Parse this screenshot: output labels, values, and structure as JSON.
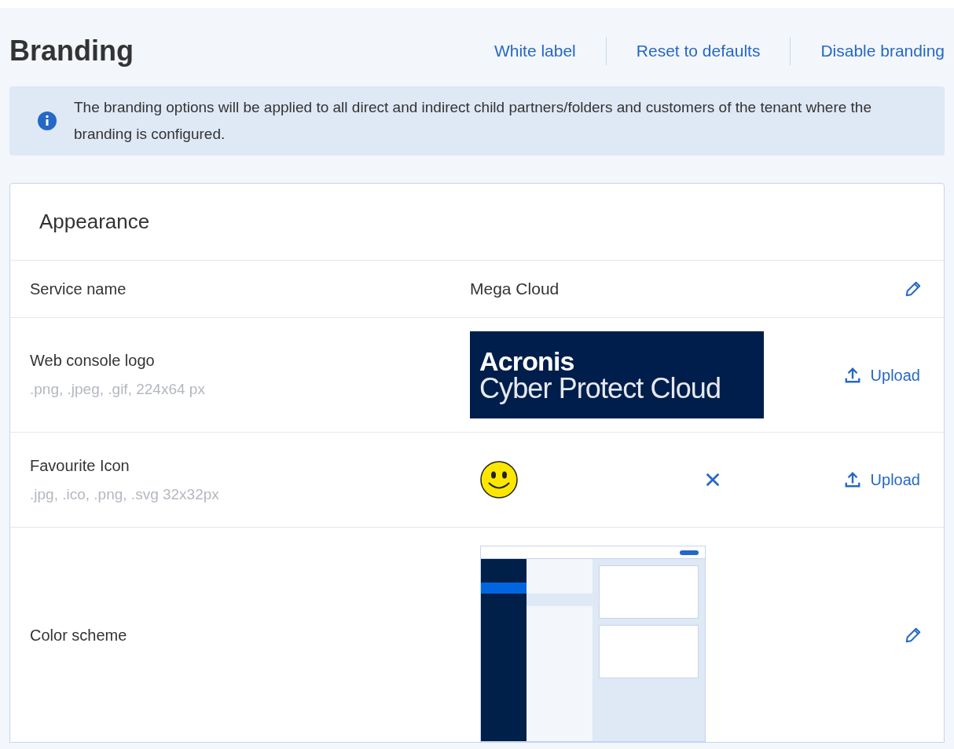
{
  "title": "Branding",
  "header_links": [
    "White label",
    "Reset to defaults",
    "Disable branding"
  ],
  "info": "The branding options will be applied to all direct and indirect child partners/folders and customers of the tenant where the branding is configured.",
  "section": {
    "title": "Appearance",
    "rows": [
      {
        "kind": "text",
        "label": "Service name",
        "value": "Mega Cloud"
      },
      {
        "kind": "logo",
        "label": "Web console logo",
        "hint": ".png, .jpeg, .gif, 224x64 px",
        "logo_lines": [
          "Acronis",
          "Cyber Protect Cloud"
        ],
        "action": "Upload"
      },
      {
        "kind": "favicon",
        "label": "Favourite Icon",
        "hint": ".jpg, .ico, .png, .svg 32x32px",
        "action": "Upload"
      },
      {
        "kind": "scheme",
        "label": "Color scheme"
      }
    ]
  }
}
